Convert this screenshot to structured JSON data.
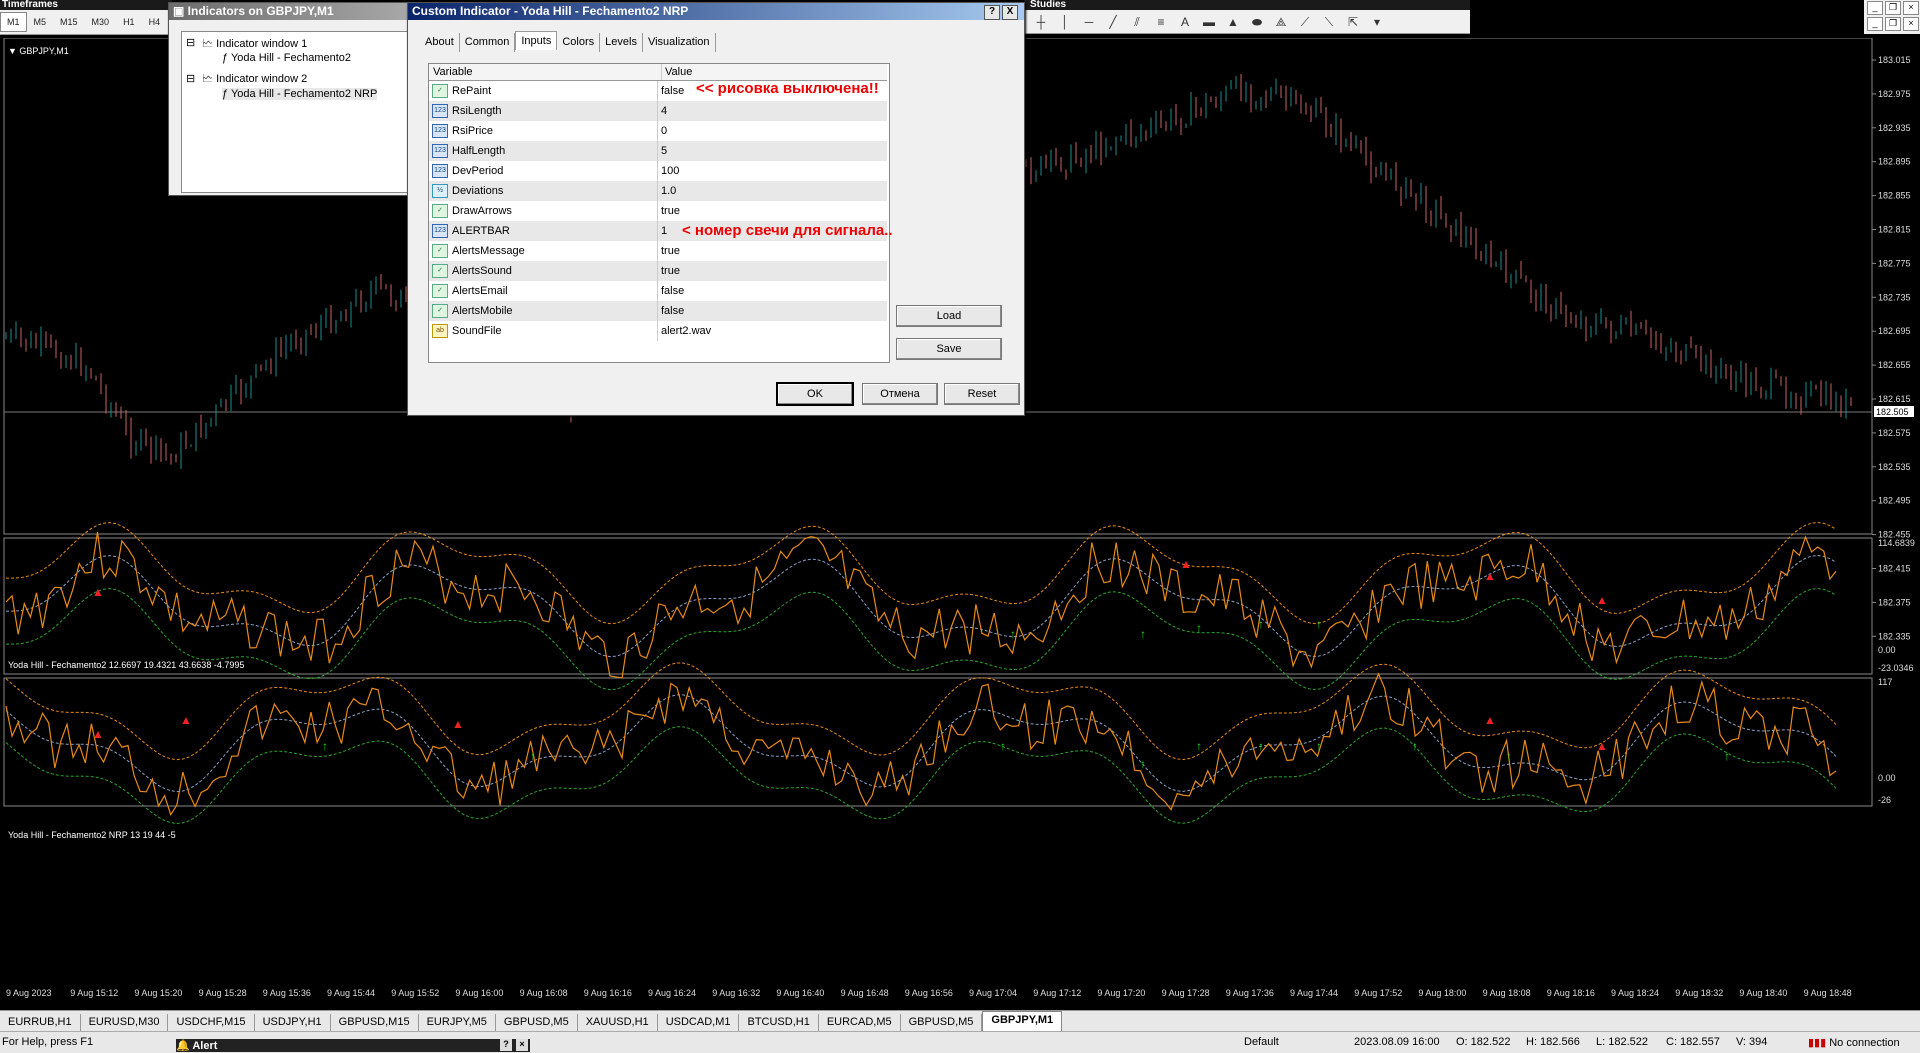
{
  "timeframes": {
    "title": "Timeframes",
    "items": [
      "M1",
      "M5",
      "M15",
      "M30",
      "H1",
      "H4"
    ],
    "active": "M1"
  },
  "studies": {
    "title": "Studies"
  },
  "chart": {
    "symbol_label": "GBPJPY,M1",
    "price_axis": [
      "183.015",
      "182.975",
      "182.935",
      "182.895",
      "182.855",
      "182.815",
      "182.775",
      "182.735",
      "182.695",
      "182.655",
      "182.615",
      "182.575",
      "182.535",
      "182.495",
      "182.455",
      "182.415",
      "182.375",
      "182.335"
    ],
    "current_price": "182.505",
    "sub1_label": "Yoda Hill - Fechamento2 12.6697 19.4321 43.6638 -4.7995",
    "sub1_axis": [
      "114.6839",
      "0.00",
      "-23.0346"
    ],
    "sub2_label": "Yoda Hill - Fechamento2 NRP 13 19 44 -5",
    "sub2_axis": [
      "117",
      "0.00",
      "-26"
    ],
    "time_axis": [
      "9 Aug 2023",
      "9 Aug 15:12",
      "9 Aug 15:20",
      "9 Aug 15:28",
      "9 Aug 15:36",
      "9 Aug 15:44",
      "9 Aug 15:52",
      "9 Aug 16:00",
      "9 Aug 16:08",
      "9 Aug 16:16",
      "9 Aug 16:24",
      "9 Aug 16:32",
      "9 Aug 16:40",
      "9 Aug 16:48",
      "9 Aug 16:56",
      "9 Aug 17:04",
      "9 Aug 17:12",
      "9 Aug 17:20",
      "9 Aug 17:28",
      "9 Aug 17:36",
      "9 Aug 17:44",
      "9 Aug 17:52",
      "9 Aug 18:00",
      "9 Aug 18:08",
      "9 Aug 18:16",
      "9 Aug 18:24",
      "9 Aug 18:32",
      "9 Aug 18:40",
      "9 Aug 18:48"
    ],
    "colors": {
      "bull": "#1e8c8c",
      "bear": "#c86464",
      "band": "#e88a1a",
      "lower": "#2aa62a",
      "mid": "#8aa0c8",
      "up_arrow": "#22dd22",
      "down_arrow": "#ee2222"
    }
  },
  "indicators_window": {
    "title": "Indicators on GBPJPY,M1",
    "tree": [
      {
        "label": "Indicator window 1"
      },
      {
        "label": "Yoda Hill - Fechamento2"
      },
      {
        "label": "Indicator window 2"
      },
      {
        "label": "Yoda Hill - Fechamento2 NRP"
      }
    ]
  },
  "dialog": {
    "title": "Custom Indicator - Yoda Hill - Fechamento2 NRP",
    "help_btn": "?",
    "close_btn": "X",
    "tabs": [
      "About",
      "Common",
      "Inputs",
      "Colors",
      "Levels",
      "Visualization"
    ],
    "active_tab": "Inputs",
    "col_variable": "Variable",
    "col_value": "Value",
    "params": [
      {
        "name": "RePaint",
        "value": "false",
        "icon": "bool"
      },
      {
        "name": "RsiLength",
        "value": "4",
        "icon": "int"
      },
      {
        "name": "RsiPrice",
        "value": "0",
        "icon": "int"
      },
      {
        "name": "HalfLength",
        "value": "5",
        "icon": "int"
      },
      {
        "name": "DevPeriod",
        "value": "100",
        "icon": "int"
      },
      {
        "name": "Deviations",
        "value": "1.0",
        "icon": "double"
      },
      {
        "name": "DrawArrows",
        "value": "true",
        "icon": "bool"
      },
      {
        "name": "ALERTBAR",
        "value": "1",
        "icon": "int"
      },
      {
        "name": "AlertsMessage",
        "value": "true",
        "icon": "bool"
      },
      {
        "name": "AlertsSound",
        "value": "true",
        "icon": "bool"
      },
      {
        "name": "AlertsEmail",
        "value": "false",
        "icon": "bool"
      },
      {
        "name": "AlertsMobile",
        "value": "false",
        "icon": "bool"
      },
      {
        "name": "SoundFile",
        "value": "alert2.wav",
        "icon": "string"
      }
    ],
    "icon_text": {
      "bool": "✓",
      "int": "123",
      "double": "½",
      "string": "ab"
    },
    "annotation_repaint": "<< рисовка выключена!!",
    "annotation_alertbar": "< номер свечи для сигнала..",
    "load_btn": "Load",
    "save_btn": "Save",
    "ok_btn": "OK",
    "cancel_btn": "Отмена",
    "reset_btn": "Reset"
  },
  "symbol_tabs": [
    "EURRUB,H1",
    "EURUSD,M30",
    "USDCHF,M15",
    "USDJPY,H1",
    "GBPUSD,M15",
    "EURJPY,M5",
    "GBPUSD,M5",
    "XAUUSD,H1",
    "USDCAD,M1",
    "BTCUSD,H1",
    "EURCAD,M5",
    "GBPUSD,M5",
    "GBPJPY,M1"
  ],
  "active_symbol_tab": "GBPJPY,M1",
  "status": {
    "help": "For Help, press F1",
    "alert": "Alert",
    "profile": "Default",
    "datetime": "2023.08.09 16:00",
    "open": "O: 182.522",
    "high": "H: 182.566",
    "low": "L: 182.522",
    "close": "C: 182.557",
    "volume": "V: 394",
    "connection": "No connection"
  }
}
